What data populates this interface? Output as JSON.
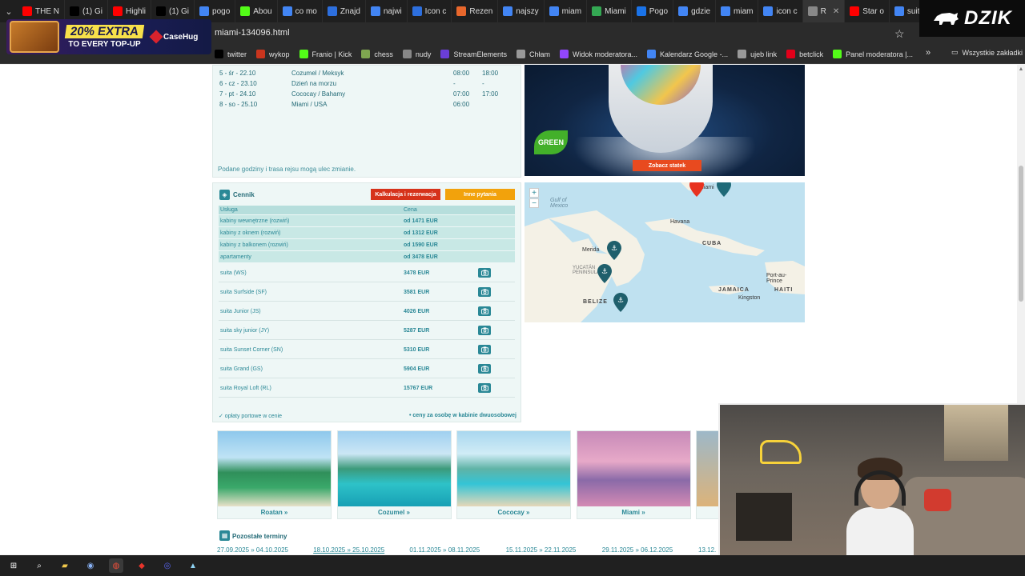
{
  "browser": {
    "tabs": [
      {
        "label": "THE N",
        "icon": "youtube-icon",
        "color": "#ff0000"
      },
      {
        "label": "(1) Gi",
        "icon": "x-icon",
        "color": "#000000"
      },
      {
        "label": "Highli",
        "icon": "youtube-icon",
        "color": "#ff0000"
      },
      {
        "label": "(1) Gi",
        "icon": "x-icon",
        "color": "#000000"
      },
      {
        "label": "pogo",
        "icon": "google-icon",
        "color": "#4285f4"
      },
      {
        "label": "Abou",
        "icon": "kick-icon",
        "color": "#53fc18"
      },
      {
        "label": "co mo",
        "icon": "google-icon",
        "color": "#4285f4"
      },
      {
        "label": "Znajd",
        "icon": "doc-icon",
        "color": "#2d6fde"
      },
      {
        "label": "najwi",
        "icon": "google-icon",
        "color": "#4285f4"
      },
      {
        "label": "Icon c",
        "icon": "pen-icon",
        "color": "#2d6fde"
      },
      {
        "label": "Rezen",
        "icon": "k-icon",
        "color": "#e8672c"
      },
      {
        "label": "najszy",
        "icon": "google-icon",
        "color": "#4285f4"
      },
      {
        "label": "miam",
        "icon": "google-icon",
        "color": "#4285f4"
      },
      {
        "label": "Miami",
        "icon": "maps-icon",
        "color": "#34a853"
      },
      {
        "label": "Pogo",
        "icon": "weather-icon",
        "color": "#1a73e8"
      },
      {
        "label": "gdzie",
        "icon": "google-icon",
        "color": "#4285f4"
      },
      {
        "label": "miam",
        "icon": "google-icon",
        "color": "#4285f4"
      },
      {
        "label": "icon c",
        "icon": "google-icon",
        "color": "#4285f4"
      },
      {
        "label": "R",
        "icon": "page-icon",
        "color": "#888888",
        "active": true
      },
      {
        "label": "Star o",
        "icon": "youtube-icon",
        "color": "#ff0000"
      },
      {
        "label": "suita",
        "icon": "google-icon",
        "color": "#4285f4"
      }
    ],
    "url": "miami-134096.html",
    "bookmarks": [
      {
        "label": "twitter",
        "icon": "x-icon",
        "color": "#000000"
      },
      {
        "label": "wykop",
        "icon": "wykop-icon",
        "color": "#c9351e"
      },
      {
        "label": "Franio | Kick",
        "icon": "kick-icon",
        "color": "#53fc18"
      },
      {
        "label": "chess",
        "icon": "pawn-icon",
        "color": "#7fa650"
      },
      {
        "label": "nudy",
        "icon": "folder-icon",
        "color": "#888888"
      },
      {
        "label": "StreamElements",
        "icon": "streamelements-icon",
        "color": "#6a3ed8"
      },
      {
        "label": "Chłam",
        "icon": "globe-icon",
        "color": "#999999"
      },
      {
        "label": "Widok moderatora...",
        "icon": "twitch-icon",
        "color": "#9146ff"
      },
      {
        "label": "Kalendarz Google -...",
        "icon": "calendar-icon",
        "color": "#4285f4"
      },
      {
        "label": "ujeb link",
        "icon": "globe-icon",
        "color": "#999999"
      },
      {
        "label": "betclick",
        "icon": "betclick-icon",
        "color": "#e2001a"
      },
      {
        "label": "Panel moderatora |...",
        "icon": "kick-icon",
        "color": "#53fc18"
      }
    ],
    "bookmarks_all": "Wszystkie zakładki"
  },
  "ad": {
    "line1": "20% EXTRA",
    "line2": "TO EVERY TOP-UP",
    "brand": "CaseHug"
  },
  "streamer_badge": {
    "text": "DZIK"
  },
  "itinerary": {
    "rows": [
      {
        "day": "5 - śr - 22.10",
        "place": "Cozumel / Meksyk",
        "arrive": "08:00",
        "depart": "18:00"
      },
      {
        "day": "6 - cz - 23.10",
        "place": "Dzień na morzu",
        "arrive": "-",
        "depart": "-"
      },
      {
        "day": "7 - pt - 24.10",
        "place": "Cococay / Bahamy",
        "arrive": "07:00",
        "depart": "17:00"
      },
      {
        "day": "8 - so - 25.10",
        "place": "Miami / USA",
        "arrive": "06:00",
        "depart": ""
      }
    ],
    "note": "Podane godziny i trasa rejsu mogą ulec zmianie."
  },
  "ship": {
    "green_badge": "GREEN",
    "see_ship_button": "Zobacz statek"
  },
  "pricing": {
    "title": "Cennik",
    "calc_button": "Kalkulacja i rezerwacja",
    "questions_button": "Inne pytania",
    "col_service": "Usługa",
    "col_price": "Cena",
    "cabins": [
      {
        "name": "kabiny wewnętrzne  (rozwiń)",
        "price": "od 1471 EUR"
      },
      {
        "name": "kabiny z oknem  (rozwiń)",
        "price": "od 1312 EUR"
      },
      {
        "name": "kabiny z balkonem  (rozwiń)",
        "price": "od 1590 EUR"
      },
      {
        "name": "apartamenty",
        "price": "od 3478 EUR"
      }
    ],
    "suites": [
      {
        "name": "suita (WS)",
        "price": "3478 EUR"
      },
      {
        "name": "suita Surfside (SF)",
        "price": "3581 EUR"
      },
      {
        "name": "suita Junior (JS)",
        "price": "4026 EUR"
      },
      {
        "name": "suita sky junior (JY)",
        "price": "5287 EUR"
      },
      {
        "name": "suita Sunset Corner (SN)",
        "price": "5310 EUR"
      },
      {
        "name": "suita Grand (GS)",
        "price": "5904 EUR"
      },
      {
        "name": "suita Royal Loft (RL)",
        "price": "15767 EUR"
      }
    ],
    "port_fees": "✓ opłaty portowe w cenie",
    "per_person": "• ceny za osobę w kabinie dwuosobowej"
  },
  "map": {
    "labels": {
      "gulf": "Gulf of\nMexico",
      "havana": "Havana",
      "miami": "Miami",
      "cuba": "CUBA",
      "merida": "Merida",
      "yucatan": "YUCATÁN\nPENINSULA",
      "belize": "BELIZE",
      "jamaica": "JAMAICA",
      "kingston": "Kingston",
      "port_au_prince": "Port-au-\nPrince",
      "haiti": "HAITI"
    },
    "zoom_in": "+",
    "zoom_out": "−"
  },
  "destinations": [
    {
      "name": "Roatan »"
    },
    {
      "name": "Cozumel »"
    },
    {
      "name": "Cococay »"
    },
    {
      "name": "Miami »"
    }
  ],
  "other_dates": {
    "title": "Pozostałe terminy",
    "dates": [
      {
        "label": "27.09.2025 » 04.10.2025",
        "selected": false
      },
      {
        "label": "18.10.2025 » 25.10.2025",
        "selected": true
      },
      {
        "label": "01.11.2025 » 08.11.2025",
        "selected": false
      },
      {
        "label": "15.11.2025 » 22.11.2025",
        "selected": false
      },
      {
        "label": "29.11.2025 » 06.12.2025",
        "selected": false
      },
      {
        "label": "13.12.",
        "selected": false
      }
    ]
  },
  "colors": {
    "accent": "#2a8896",
    "calc_button": "#d6321a",
    "questions_button": "#f2a20c",
    "see_ship_button": "#e84a1f"
  }
}
